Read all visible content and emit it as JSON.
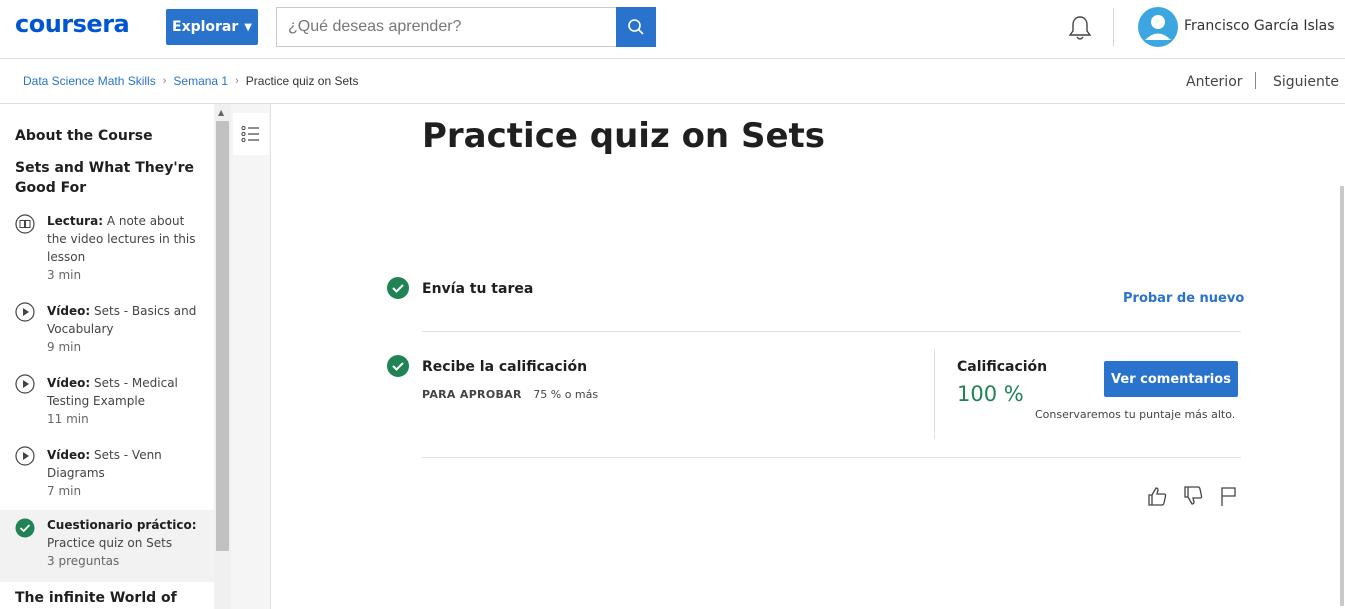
{
  "header": {
    "logo_text": "coursera",
    "explore_label": "Explorar",
    "search_placeholder": "¿Qué deseas aprender?",
    "user_name": "Francisco García Islas"
  },
  "breadcrumb": {
    "items": [
      "Data Science Math Skills",
      "Semana 1"
    ],
    "current": "Practice quiz on Sets",
    "prev_label": "Anterior",
    "next_label": "Siguiente"
  },
  "sidebar": {
    "section_about": "About the Course",
    "section_sets": "Sets and What They're Good For",
    "items": [
      {
        "type": "Lectura:",
        "title": "A note about the video lectures in this lesson",
        "duration": "3 min",
        "icon": "reading-icon"
      },
      {
        "type": "Vídeo:",
        "title": "Sets - Basics and Vocabulary",
        "duration": "9 min",
        "icon": "play-icon"
      },
      {
        "type": "Vídeo:",
        "title": "Sets - Medical Testing Example",
        "duration": "11 min",
        "icon": "play-icon"
      },
      {
        "type": "Vídeo:",
        "title": "Sets - Venn Diagrams",
        "duration": "7 min",
        "icon": "play-icon"
      },
      {
        "type": "Cuestionario práctico:",
        "title": "Practice quiz on Sets",
        "duration": "3 preguntas",
        "icon": "check-icon",
        "active": true
      }
    ],
    "section_next": "The infinite World of"
  },
  "main": {
    "title": "Practice quiz on Sets",
    "step1_label": "Envía tu tarea",
    "retry_label": "Probar de nuevo",
    "step2_label": "Recibe la calificación",
    "pass_label": "PARA APROBAR",
    "pass_value": "75 % o más",
    "grade_label": "Calificación",
    "grade_value": "100 %",
    "feedback_button": "Ver comentarios",
    "keep_note": "Conservaremos tu puntaje más alto."
  },
  "colors": {
    "brand": "#0056d2",
    "button": "#2a73cc",
    "success": "#1f8354"
  }
}
